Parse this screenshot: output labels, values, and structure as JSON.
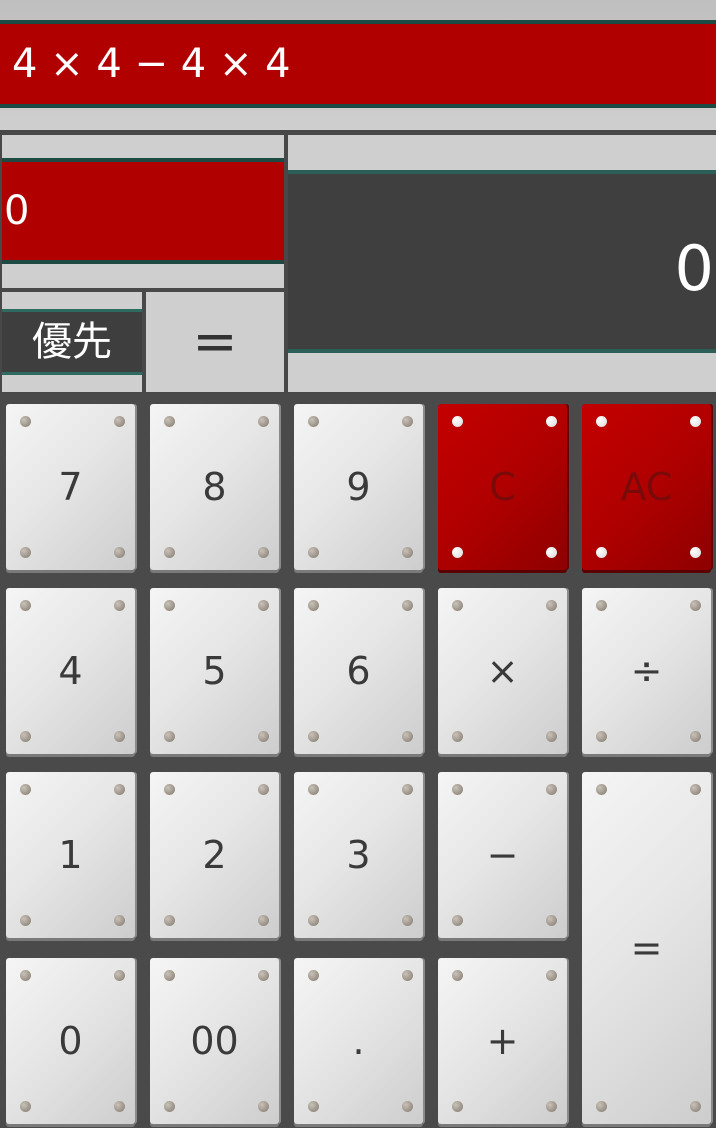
{
  "formula": "4 × 4 − 4 × 4",
  "memory_value": "0",
  "priority_label": "優先",
  "small_equals_label": "=",
  "result_value": "0",
  "keypad": {
    "row1": [
      "7",
      "8",
      "9",
      "C",
      "AC"
    ],
    "row2": [
      "4",
      "5",
      "6",
      "×",
      "÷"
    ],
    "row3": [
      "1",
      "2",
      "3",
      "−"
    ],
    "row4": [
      "0",
      "00",
      ".",
      "+"
    ],
    "equals": "="
  },
  "colors": {
    "display_red": "#b10000",
    "display_dark": "#3f3f3f",
    "key_silver": "#e6e6e6",
    "background": "#4a4a4a"
  }
}
